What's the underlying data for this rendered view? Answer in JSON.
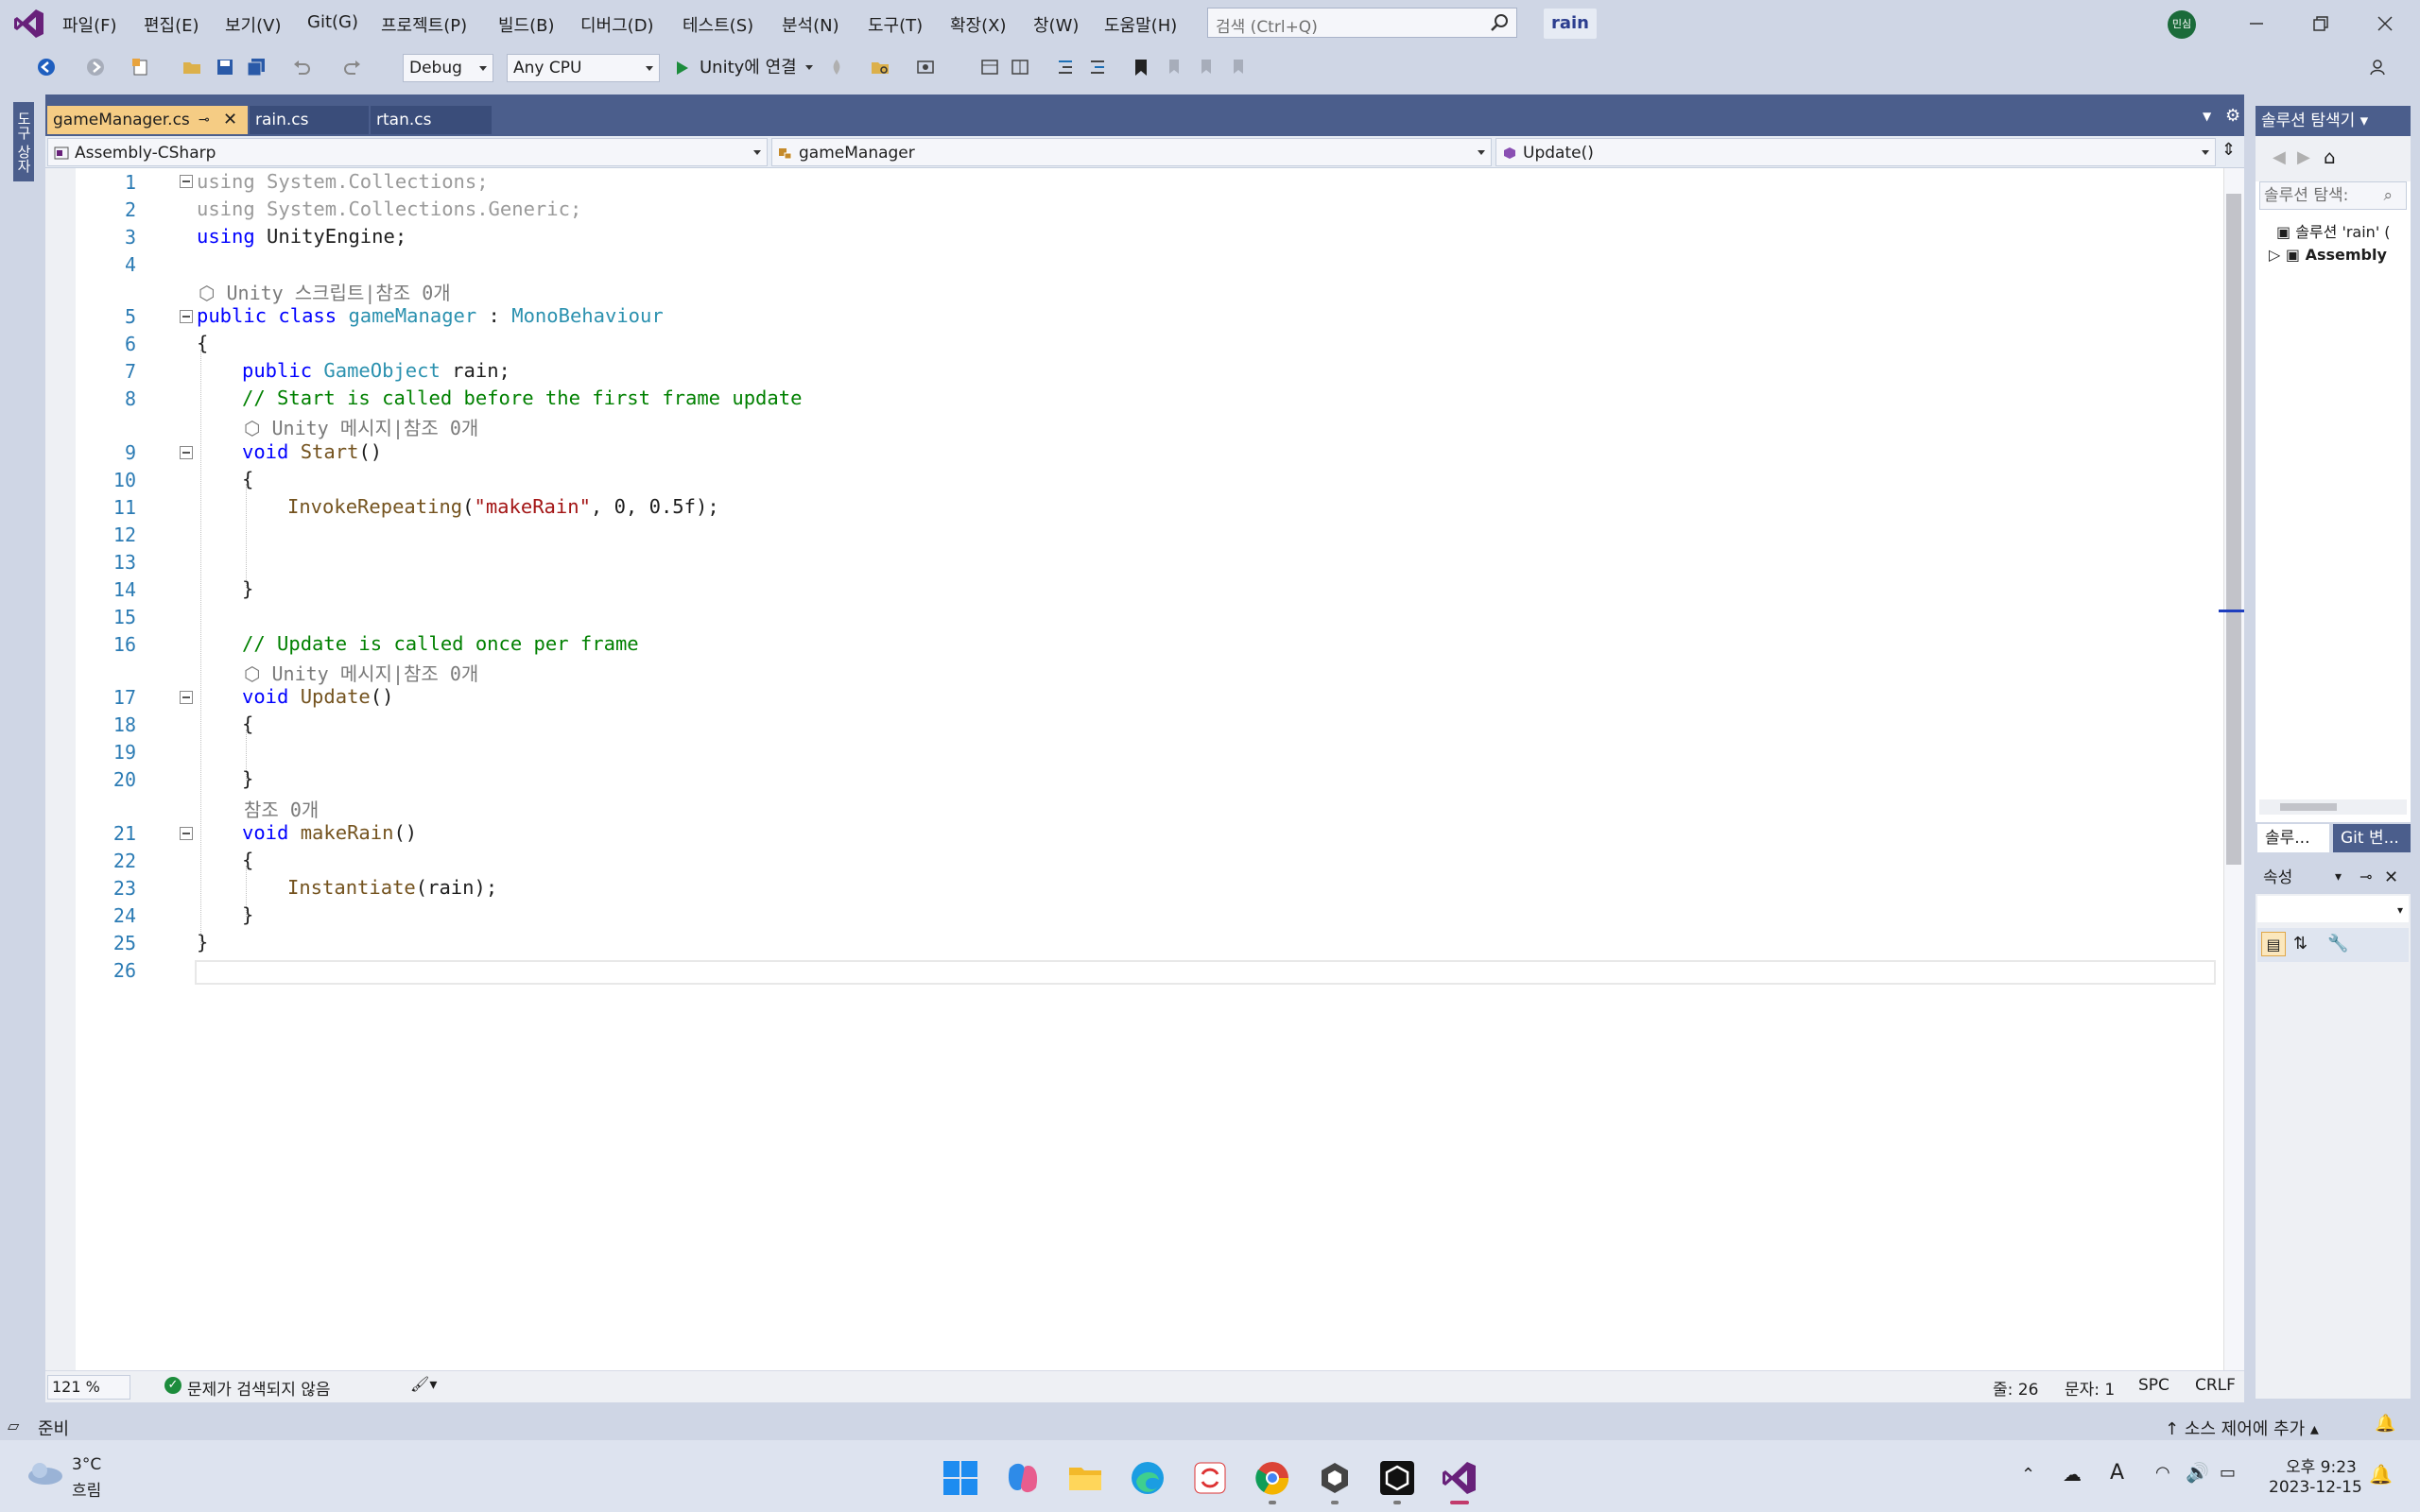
{
  "menubar": {
    "items": [
      "파일(F)",
      "편집(E)",
      "보기(V)",
      "Git(G)",
      "프로젝트(P)",
      "빌드(B)",
      "디버그(D)",
      "테스트(S)",
      "분석(N)",
      "도구(T)",
      "확장(X)",
      "창(W)",
      "도움말(H)"
    ],
    "search_placeholder": "검색 (Ctrl+Q)",
    "solution_name": "rain",
    "avatar_initials": "민심"
  },
  "toolbar": {
    "configuration": "Debug",
    "platform": "Any CPU",
    "run_label": "Unity에 연결"
  },
  "left_strip": {
    "toolbox_label": "도구 상자"
  },
  "tabs": [
    {
      "label": "gameManager.cs",
      "active": true
    },
    {
      "label": "rain.cs",
      "active": false
    },
    {
      "label": "rtan.cs",
      "active": false
    }
  ],
  "navbar": {
    "project": "Assembly-CSharp",
    "type": "gameManager",
    "member": "Update()"
  },
  "code": {
    "line_numbers": [
      "1",
      "2",
      "3",
      "4",
      "5",
      "6",
      "7",
      "8",
      "9",
      "10",
      "11",
      "12",
      "13",
      "14",
      "15",
      "16",
      "17",
      "18",
      "19",
      "20",
      "21",
      "22",
      "23",
      "24",
      "25",
      "26"
    ],
    "lens": {
      "class": "Unity 스크립트|참조 0개",
      "start": "Unity 메시지|참조 0개",
      "update": "Unity 메시지|참조 0개",
      "makerain": "참조 0개"
    },
    "lines": {
      "l1_kw": "using",
      "l1_rest": " System.Collections;",
      "l2_kw": "using",
      "l2_rest": " System.Collections.Generic;",
      "l3_kw": "using",
      "l3_rest": " UnityEngine;",
      "l5_kw": "public class",
      "l5_name": "gameManager",
      "l5_sep": " : ",
      "l5_base": "MonoBehaviour",
      "l6": "{",
      "l7_kw": "public",
      "l7_type": "GameObject",
      "l7_rest": " rain;",
      "l8": "// Start is called before the first frame update",
      "l9_kw": "void",
      "l9_fn": "Start",
      "l9_rest": "()",
      "l10": "{",
      "l11_fn": "InvokeRepeating",
      "l11_open": "(",
      "l11_str": "\"makeRain\"",
      "l11_rest": ", 0, 0.5f);",
      "l14": "}",
      "l16": "// Update is called once per frame",
      "l17_kw": "void",
      "l17_fn": "Update",
      "l17_rest": "()",
      "l18": "{",
      "l20": "}",
      "l21_kw": "void",
      "l21_fn": "makeRain",
      "l21_rest": "()",
      "l22": "{",
      "l23_fn": "Instantiate",
      "l23_rest": "(rain);",
      "l24": "}",
      "l25": "}"
    }
  },
  "editor_status": {
    "zoom": "121 %",
    "issues": "문제가 검색되지 않음",
    "line": "줄: 26",
    "col": "문자: 1",
    "spc": "SPC",
    "eol": "CRLF"
  },
  "solution_explorer": {
    "title": "솔루션 탐색기",
    "search_placeholder": "솔루션 탐색:",
    "tree": [
      "솔루션 'rain' (",
      "Assembly"
    ],
    "bottom_tabs": [
      "솔루...",
      "Git 변..."
    ]
  },
  "properties": {
    "title": "속성"
  },
  "statusbar": {
    "ready": "준비",
    "source_control": "소스 제어에 추가"
  },
  "taskbar": {
    "weather_temp": "3°C",
    "weather_desc": "흐림",
    "time": "오후 9:23",
    "date": "2023-12-15",
    "apps": [
      "start-icon",
      "copilot-icon",
      "file-explorer-icon",
      "edge-icon",
      "sync-app-icon",
      "chrome-icon",
      "unity-hub-icon",
      "unity-icon",
      "visual-studio-icon"
    ]
  },
  "colors": {
    "vs_purple": "#68217a",
    "active_tab": "#f5cc84",
    "panel_header": "#4b5e8c",
    "keyword": "#0000ff",
    "type": "#2b91af",
    "comment": "#008000",
    "string": "#a31515"
  }
}
